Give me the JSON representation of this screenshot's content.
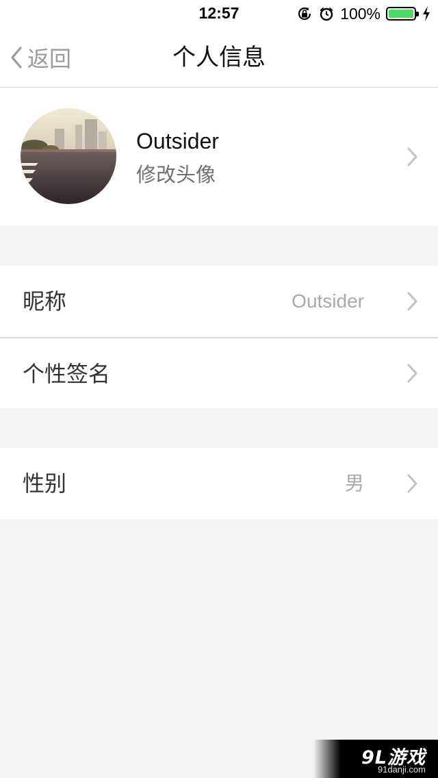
{
  "status_bar": {
    "time": "12:57",
    "battery_percent": "100%",
    "battery_level": 1.0,
    "icons": [
      "rotation-lock-icon",
      "alarm-icon",
      "battery-icon",
      "charging-icon"
    ]
  },
  "nav": {
    "back_label": "返回",
    "title": "个人信息"
  },
  "profile": {
    "name": "Outsider",
    "subtitle": "修改头像"
  },
  "rows": [
    {
      "label": "昵称",
      "value": "Outsider"
    },
    {
      "label": "个性签名",
      "value": ""
    },
    {
      "label": "性别",
      "value": "男"
    }
  ],
  "watermark": {
    "brand": "9L游戏",
    "url": "91danji.com"
  },
  "colors": {
    "background": "#f4f4f4",
    "battery_green": "#4cd964",
    "secondary_text": "#a9a9a9"
  }
}
